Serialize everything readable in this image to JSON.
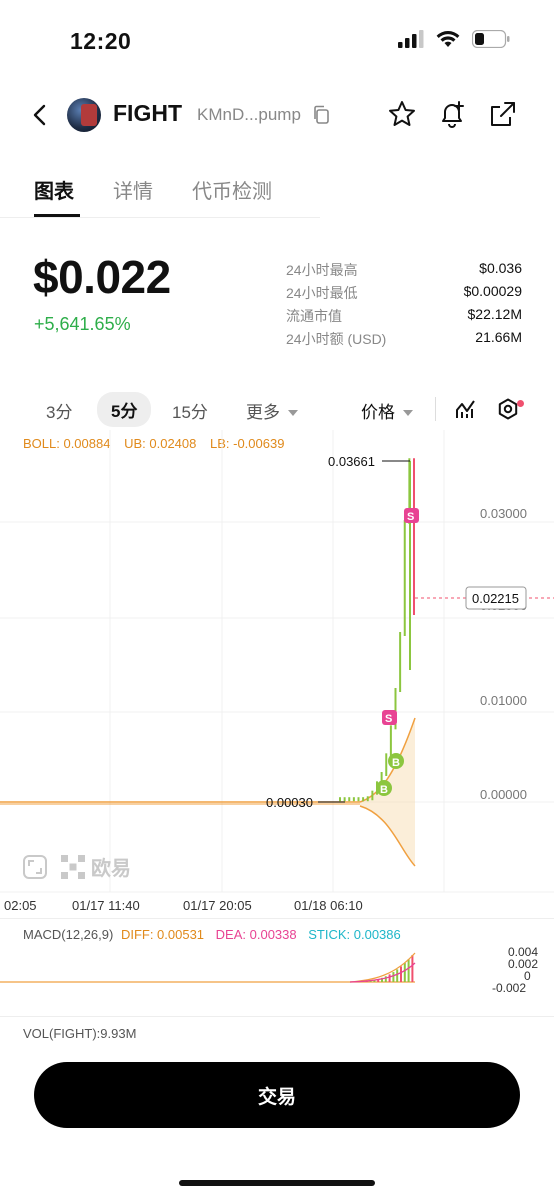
{
  "status": {
    "time": "12:20"
  },
  "header": {
    "token_name": "FIGHT",
    "token_address": "KMnD...pump"
  },
  "tabs": [
    {
      "label": "图表",
      "active": true
    },
    {
      "label": "详情",
      "active": false
    },
    {
      "label": "代币检测",
      "active": false
    }
  ],
  "price": {
    "current": "$0.022",
    "change": "+5,641.65%"
  },
  "stats": [
    {
      "label": "24小时最高",
      "value": "$0.036"
    },
    {
      "label": "24小时最低",
      "value": "$0.00029"
    },
    {
      "label": "流通市值",
      "value": "$22.12M"
    },
    {
      "label": "24小时额 (USD)",
      "value": "21.66M"
    }
  ],
  "intervals": {
    "i3": "3分",
    "i5": "5分",
    "i15": "15分",
    "more": "更多",
    "price_type": "价格"
  },
  "boll": {
    "boll": "BOLL: 0.00884",
    "ub": "UB: 0.02408",
    "lb": "LB: -0.00639"
  },
  "chart_data": {
    "type": "line",
    "title": "",
    "x_ticks": [
      "02:05",
      "01/17 11:40",
      "01/17 20:05",
      "01/18 06:10"
    ],
    "y_ticks": [
      "0.03000",
      "0.02000",
      "0.01000",
      "0.00000"
    ],
    "high_label": "0.03661",
    "low_label": "0.00030",
    "current_price_label": "0.02215",
    "series": [
      {
        "name": "price",
        "values": [
          0.0003,
          0.0003,
          0.0003,
          0.0003,
          0.0003,
          0.0003,
          0.0004,
          0.001,
          0.002,
          0.003,
          0.005,
          0.008,
          0.012,
          0.018,
          0.03,
          0.03661,
          0.02215
        ]
      }
    ],
    "markers": [
      "S",
      "S",
      "B",
      "B"
    ],
    "colors": {
      "up": "#8cc63f",
      "down": "#f0506e",
      "boll": "#f0a040",
      "accent": "#e08a1c"
    }
  },
  "macd": {
    "label": "MACD(12,26,9)",
    "diff": "DIFF: 0.00531",
    "dea": "DEA: 0.00338",
    "stick": "STICK: 0.00386",
    "y_ticks": [
      "0.004",
      "0.002",
      "0",
      "-0.002"
    ]
  },
  "volume": {
    "label": "VOL(FIGHT):9.93M"
  },
  "watermark": "欧易",
  "trade_button": "交易"
}
